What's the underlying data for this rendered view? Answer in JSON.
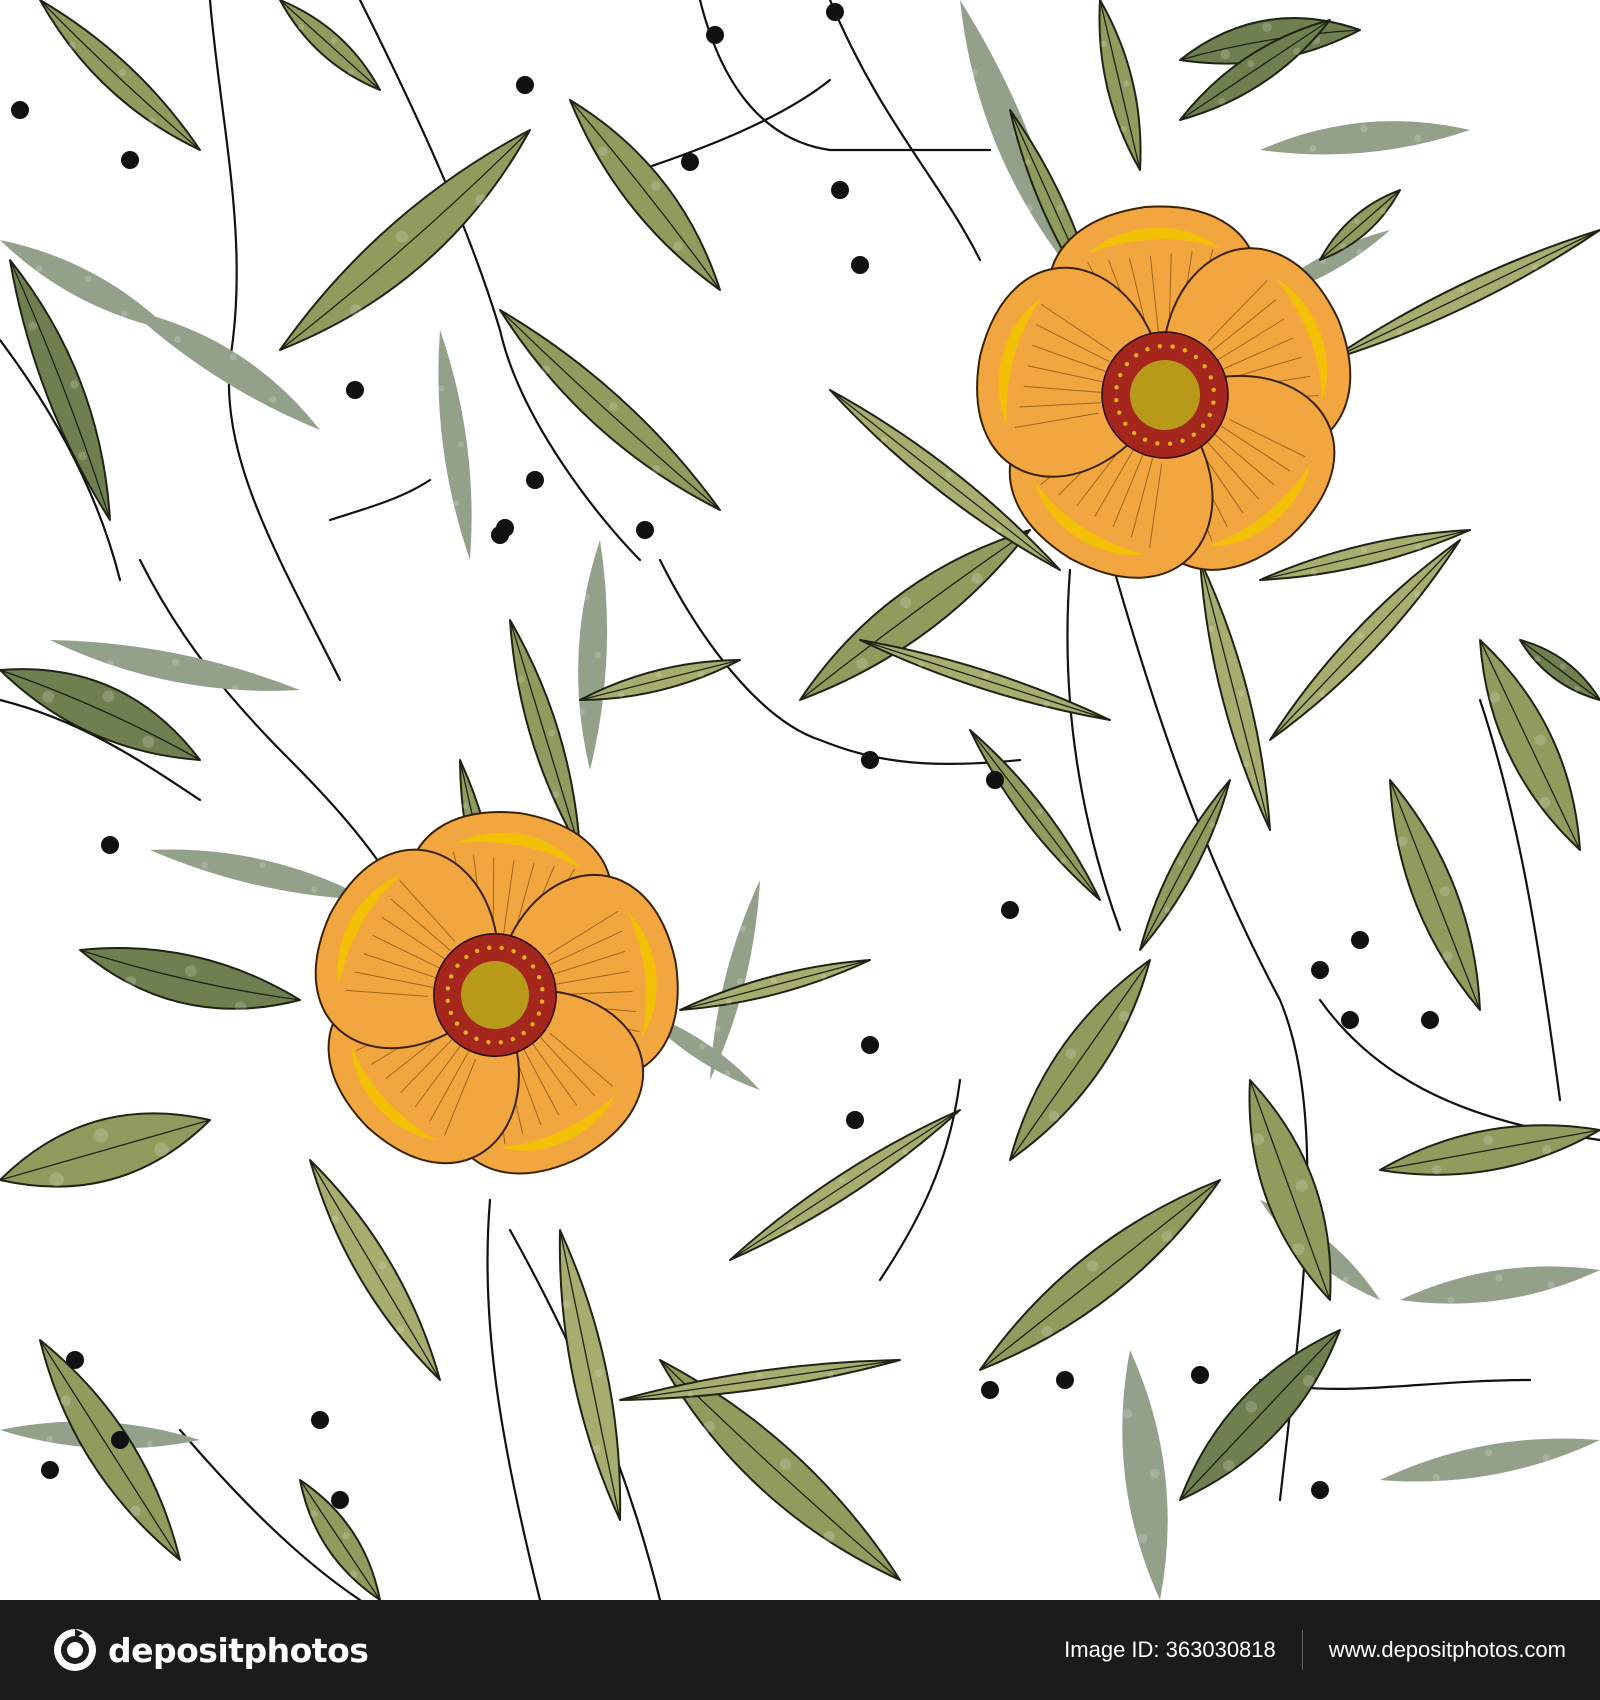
{
  "image": {
    "subject": "seamless floral pattern",
    "background_color": "#ffffff",
    "colors": {
      "leaf_dark": "#6f7f4f",
      "leaf_mid": "#8f9c5e",
      "leaf_shadow": "#93a08a",
      "leaf_fill_light": "#a6ad6e",
      "petal_orange": "#f2a640",
      "petal_yellow": "#f2c400",
      "flower_center": "#a4261c",
      "stem_ink": "#111111",
      "berry": "#111111"
    },
    "icons": [
      "flower-icon",
      "leaf-icon",
      "berry-icon"
    ]
  },
  "footer": {
    "background_color": "#1b1b1b",
    "divider_color": "#666666",
    "brand_icon": "depositphotos-logo-icon",
    "brand_name": "depositphotos",
    "image_id_text": "Image ID: 363030818",
    "website": "www.depositphotos.com"
  }
}
